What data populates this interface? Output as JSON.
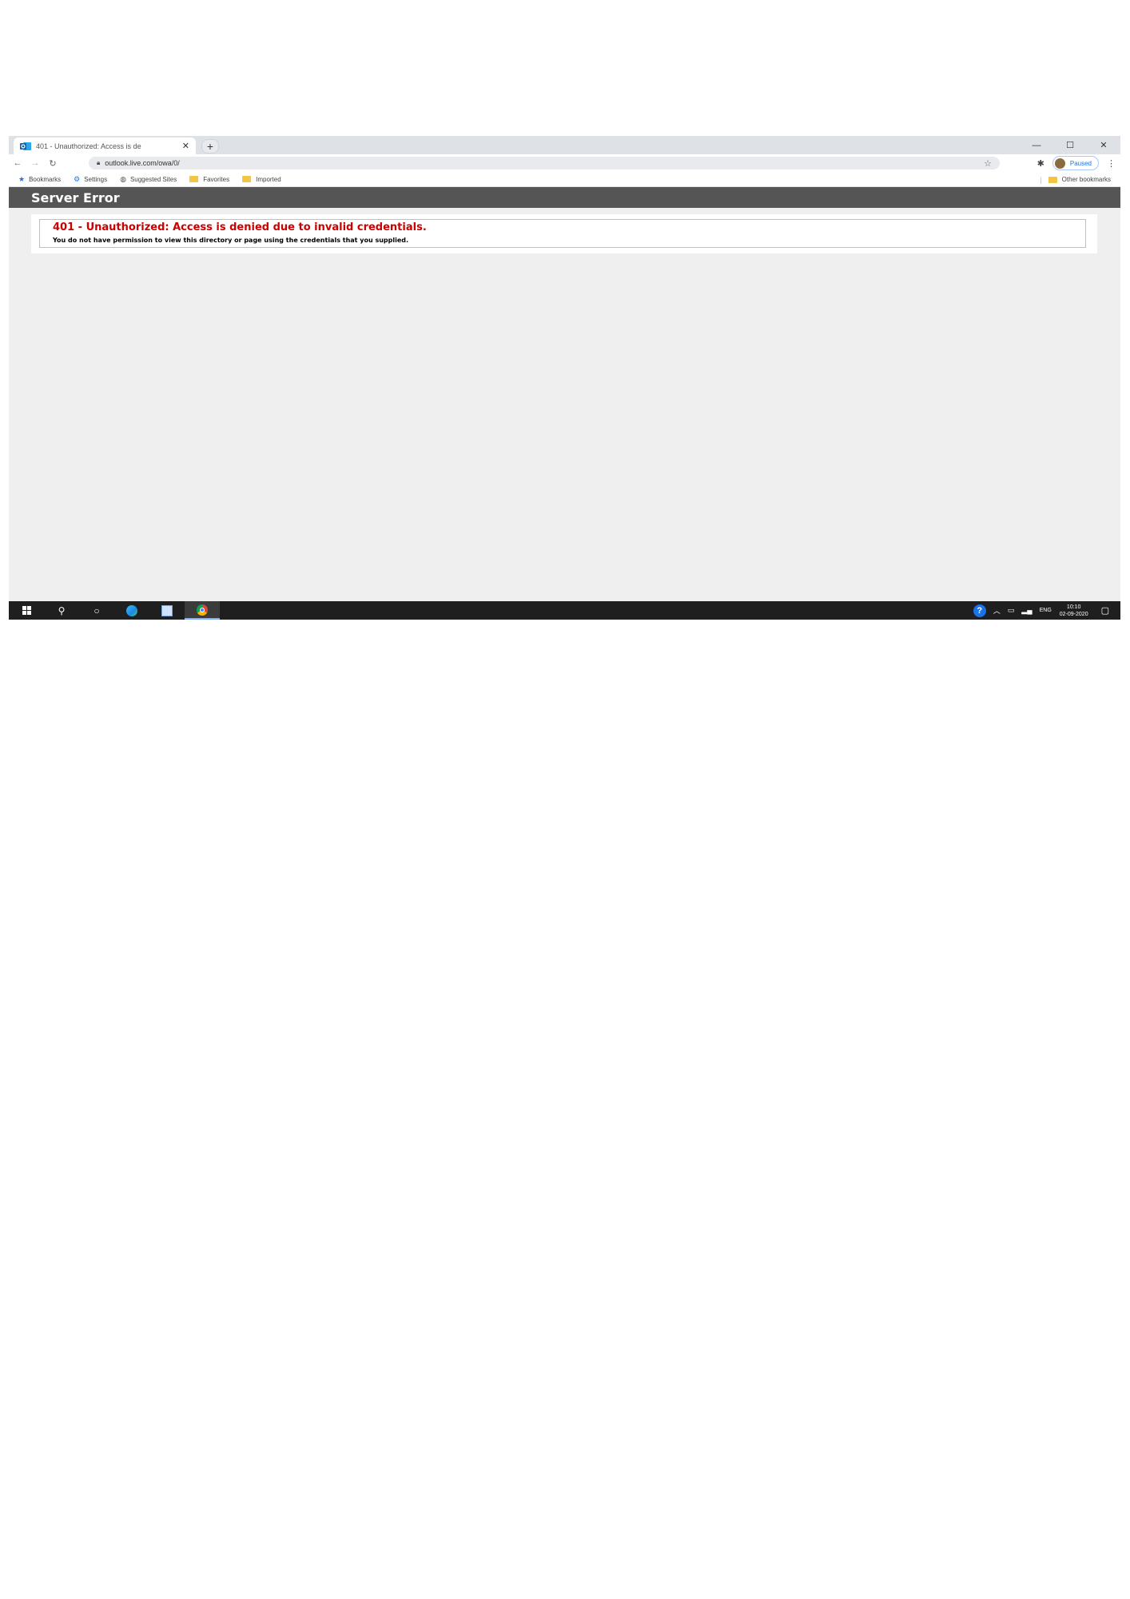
{
  "tab": {
    "title": "401 - Unauthorized: Access is de",
    "favicon_icon": "outlook-icon",
    "close_label": "✕",
    "new_tab_label": "+"
  },
  "window_controls": {
    "minimize": "—",
    "maximize": "☐",
    "close": "✕"
  },
  "toolbar": {
    "url": "outlook.live.com/owa/0/",
    "profile_label": "Paused"
  },
  "bookmarks": {
    "items": [
      {
        "label": "Bookmarks",
        "icon": "star-icon"
      },
      {
        "label": "Settings",
        "icon": "gear-icon"
      },
      {
        "label": "Suggested Sites",
        "icon": "globe-icon"
      },
      {
        "label": "Favorites",
        "icon": "folder-icon"
      },
      {
        "label": "Imported",
        "icon": "folder-icon"
      }
    ],
    "other": "Other bookmarks"
  },
  "page": {
    "header": "Server Error",
    "error_title": "401 - Unauthorized: Access is denied due to invalid credentials.",
    "error_description": "You do not have permission to view this directory or page using the credentials that you supplied.",
    "error_color": "#cc0000",
    "header_color": "#555555"
  },
  "taskbar": {
    "language": "ENG",
    "time": "10:10",
    "date": "02-09-2020",
    "apps": [
      "start-icon",
      "search-icon",
      "task-view-icon",
      "edge-icon",
      "store-icon",
      "chrome-icon"
    ]
  }
}
